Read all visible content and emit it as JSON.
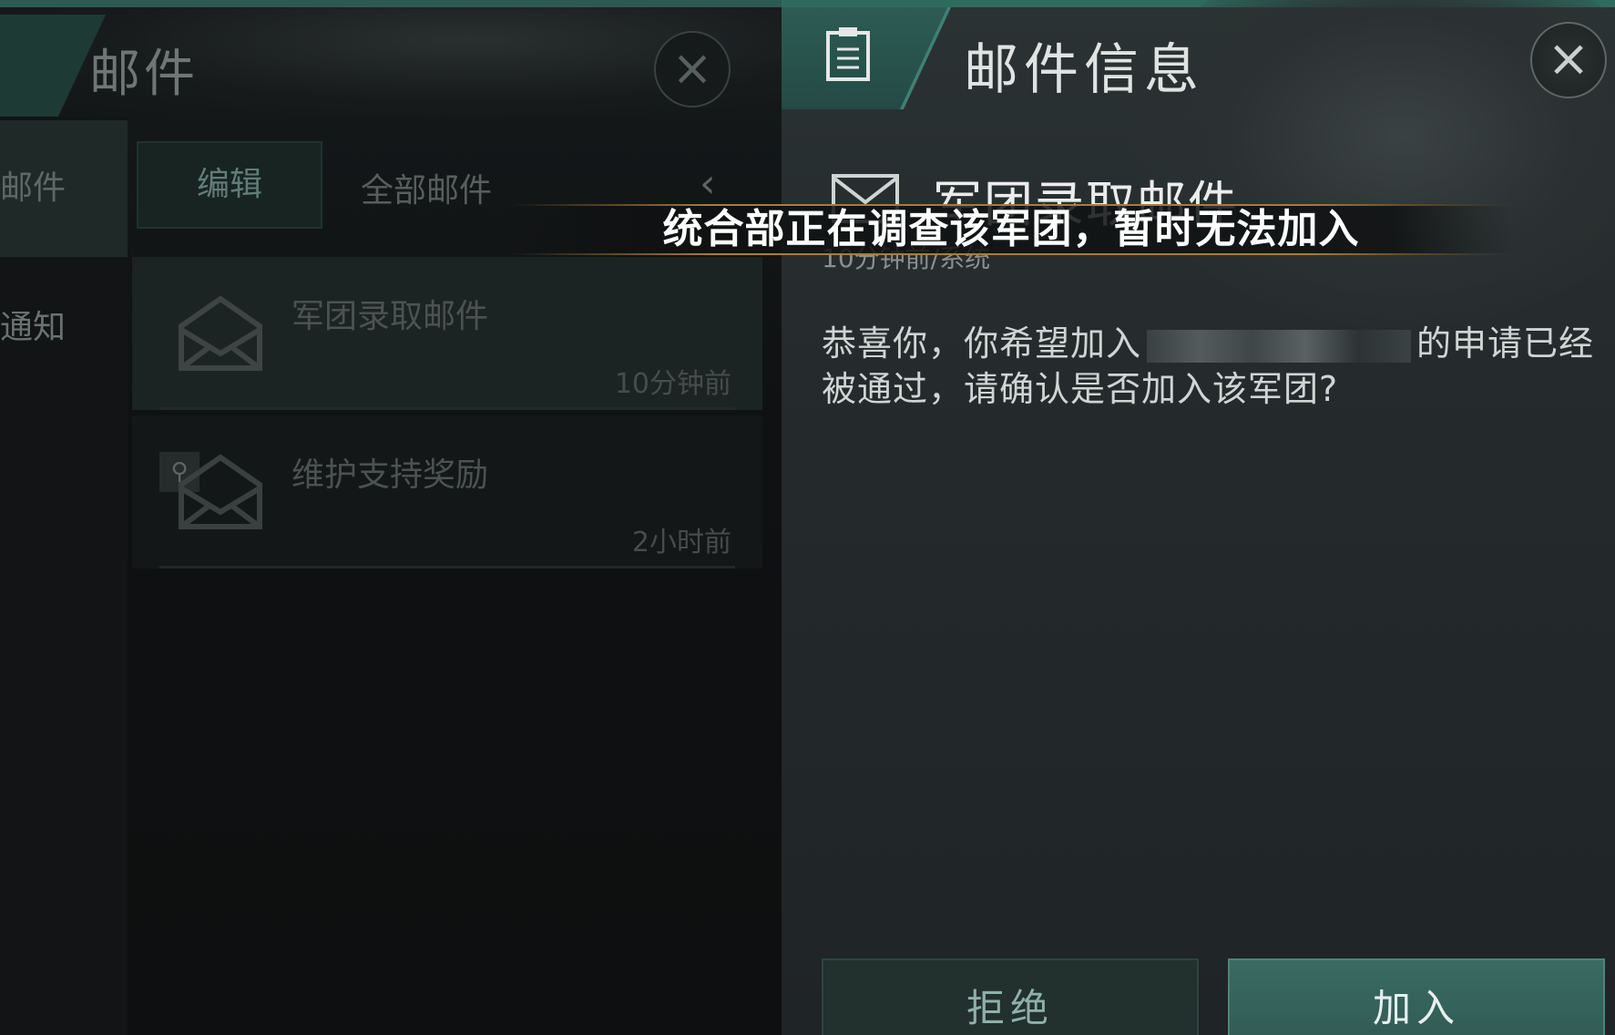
{
  "mail_list": {
    "title": "邮件",
    "sidebar": [
      {
        "label": "邮件"
      },
      {
        "label": "通知"
      }
    ],
    "edit_label": "编辑",
    "filter_label": "全部邮件",
    "collapse_glyph": "‹",
    "items": [
      {
        "subject": "军团录取邮件",
        "time": "10分钟前"
      },
      {
        "subject": "维护支持奖励",
        "time": "2小时前"
      }
    ]
  },
  "mail_detail": {
    "title": "邮件信息",
    "subject": "军团录取邮件",
    "meta": "10分钟前/系统",
    "body_before": "恭喜你，你希望加入",
    "body_after": "的申请已经被通过，请确认是否加入该军团?",
    "reject_label": "拒绝",
    "join_label": "加入"
  },
  "toast": {
    "message": "统合部正在调查该军团，暂时无法加入"
  },
  "colors": {
    "accent": "#2f6a5f",
    "toast_border": "#a77c3a"
  }
}
